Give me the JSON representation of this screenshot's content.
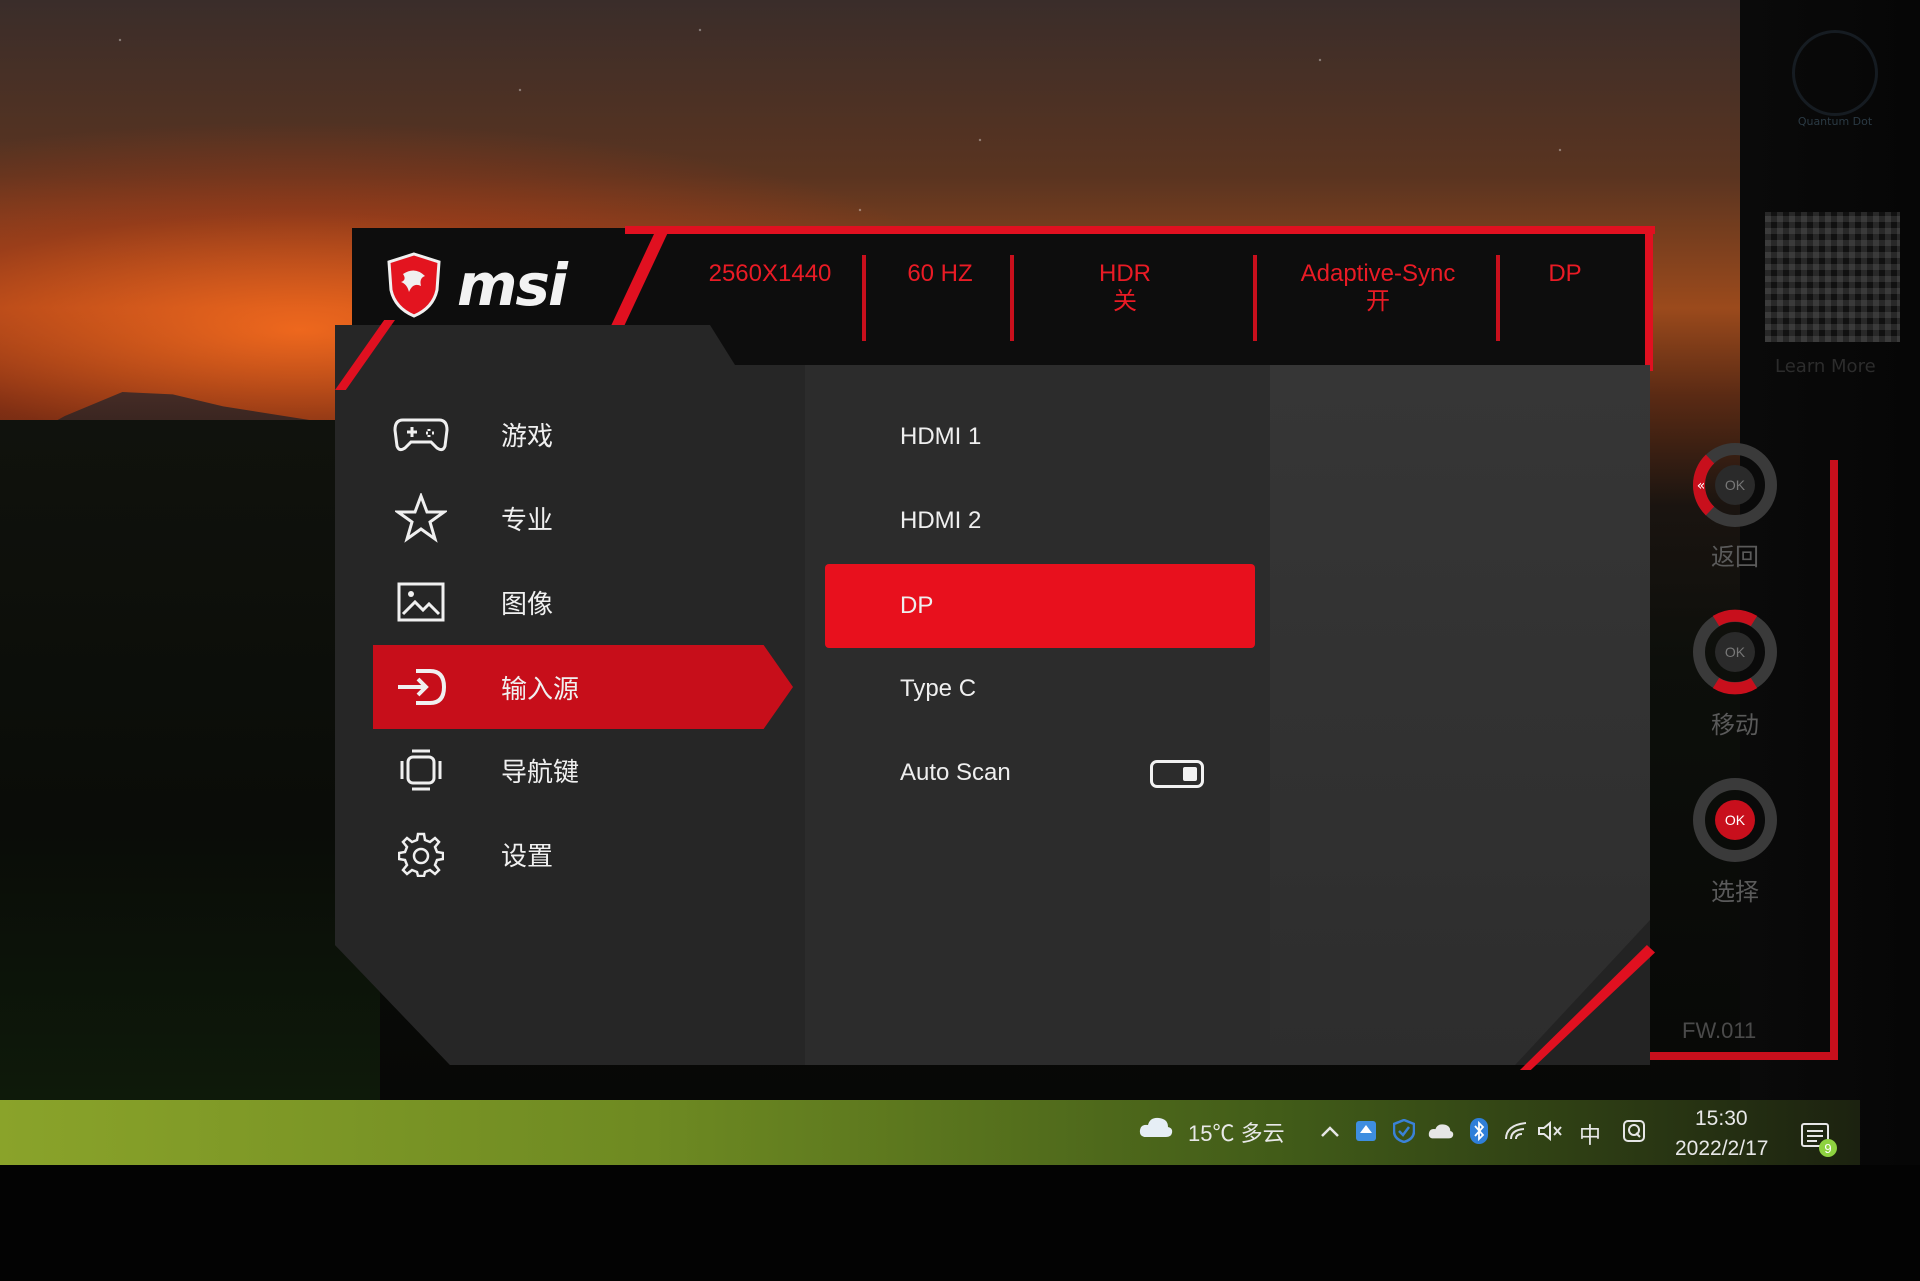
{
  "brand": {
    "logo_text": "msi"
  },
  "header_specs": [
    {
      "line1": "2560X1440",
      "line2": ""
    },
    {
      "line1": "60 HZ",
      "line2": ""
    },
    {
      "line1": "HDR",
      "line2": "关"
    },
    {
      "line1": "Adaptive-Sync",
      "line2": "开"
    },
    {
      "line1": "DP",
      "line2": ""
    }
  ],
  "main_menu": [
    {
      "label": "游戏",
      "icon": "gamepad-icon",
      "active": false
    },
    {
      "label": "专业",
      "icon": "star-icon",
      "active": false
    },
    {
      "label": "图像",
      "icon": "image-icon",
      "active": false
    },
    {
      "label": "输入源",
      "icon": "input-source-icon",
      "active": true
    },
    {
      "label": "导航键",
      "icon": "navigation-key-icon",
      "active": false
    },
    {
      "label": "设置",
      "icon": "gear-icon",
      "active": false
    }
  ],
  "input_source_menu": [
    {
      "label": "HDMI 1",
      "selected": false
    },
    {
      "label": "HDMI 2",
      "selected": false
    },
    {
      "label": "DP",
      "selected": true
    },
    {
      "label": "Type C",
      "selected": false
    },
    {
      "label": "Auto Scan",
      "selected": false,
      "toggle_on": true
    }
  ],
  "joystick_guide": [
    {
      "label": "返回",
      "key": "OK",
      "direction": "left"
    },
    {
      "label": "移动",
      "key": "OK",
      "direction": "up-down"
    },
    {
      "label": "选择",
      "key": "OK",
      "direction": "press"
    }
  ],
  "firmware": "FW.011",
  "qr": {
    "caption": "Learn More",
    "badge": "Quantum Dot"
  },
  "taskbar": {
    "weather": "15℃ 多云",
    "ime": "中",
    "time": "15:30",
    "date": "2022/2/17",
    "notification_count": "9"
  },
  "colors": {
    "accent_red": "#e8101d",
    "active_red": "#c70e1a",
    "panel_dark": "#262626",
    "panel_mid": "#2c2c2c",
    "text_light": "#f0f0f0"
  }
}
